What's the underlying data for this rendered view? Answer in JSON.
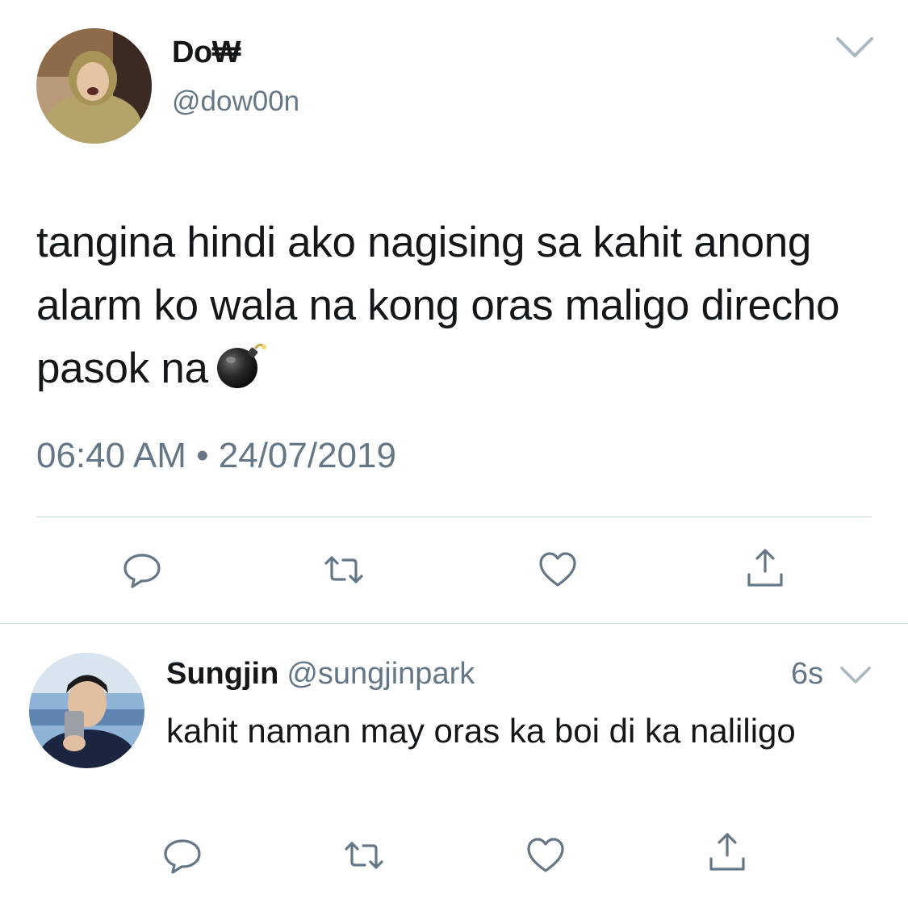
{
  "main_tweet": {
    "author_name": "Do₩",
    "author_handle": "@dow00n",
    "text": "tangina hindi ako nagising sa kahit anong alarm ko wala na kong oras maligo direcho pasok na",
    "emoji": "bomb",
    "timestamp": "06:40 AM • 24/07/2019",
    "actions": [
      "reply-icon",
      "retweet-icon",
      "like-icon",
      "share-icon"
    ]
  },
  "reply_tweet": {
    "author_name": "Sungjin",
    "author_handle": "@sungjinpark",
    "time_ago": "6s",
    "text": "kahit naman may oras ka boi di ka naliligo",
    "actions": [
      "reply-icon",
      "retweet-icon",
      "like-icon",
      "share-icon"
    ]
  },
  "colors": {
    "text_primary": "#14171a",
    "text_secondary": "#657786",
    "divider": "#ccd6dd",
    "icon": "#657786"
  }
}
